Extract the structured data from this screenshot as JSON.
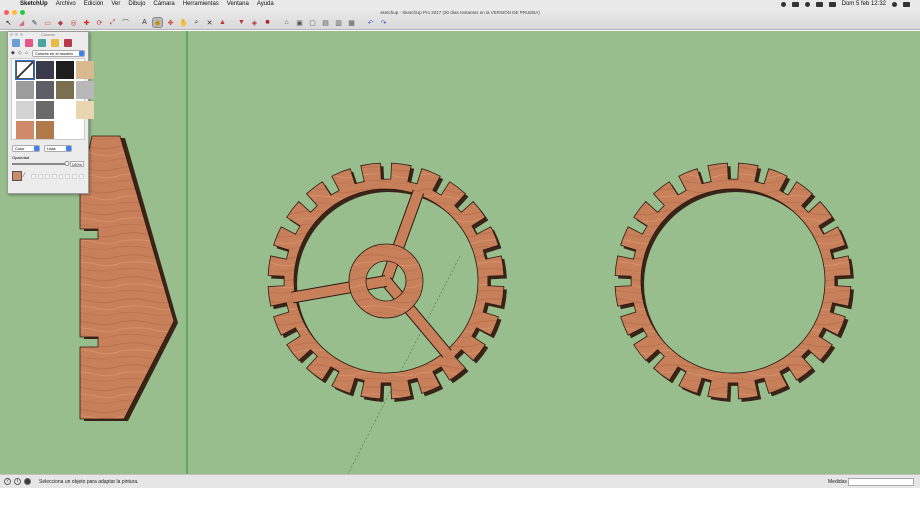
{
  "menubar": {
    "apple_symbol": "",
    "items": [
      "SketchUp",
      "Archivo",
      "Edición",
      "Ver",
      "Dibujo",
      "Cámara",
      "Herramientas",
      "Ventana",
      "Ayuda"
    ],
    "clock": "Dom 5 feb  12:32"
  },
  "window": {
    "title": "sketchup - SketchUp Pro 2017 (30 días restantes en la VERSIÓN DE PRUEBA)",
    "traffic_colors": [
      "#fe5f57",
      "#febc2e",
      "#28c840"
    ]
  },
  "toolbar": {
    "tools": [
      {
        "name": "select-tool",
        "glyph": "↖",
        "color": "#222",
        "active": false
      },
      {
        "name": "eraser-tool",
        "glyph": "◢",
        "color": "#d86a7c",
        "active": false
      },
      {
        "name": "line-tool",
        "glyph": "✎",
        "color": "#333",
        "active": false
      },
      {
        "name": "rectangle-tool",
        "glyph": "▭",
        "color": "#c54",
        "active": false
      },
      {
        "name": "push-pull-tool",
        "glyph": "◆",
        "color": "#a44",
        "active": false
      },
      {
        "name": "offset-tool",
        "glyph": "◎",
        "color": "#c33",
        "active": false
      },
      {
        "name": "move-tool",
        "glyph": "✚",
        "color": "#d22",
        "active": false
      },
      {
        "name": "rotate-tool",
        "glyph": "⟳",
        "color": "#c33",
        "active": false
      },
      {
        "name": "scale-tool",
        "glyph": "⤢",
        "color": "#c44",
        "active": false
      },
      {
        "name": "tape-measure-tool",
        "glyph": "⌒",
        "color": "#555",
        "active": false
      },
      {
        "name": "text-tool",
        "glyph": "A",
        "color": "#333",
        "active": false
      },
      {
        "name": "paint-bucket-tool",
        "glyph": "◉",
        "color": "#b80",
        "active": true
      },
      {
        "name": "orbit-tool",
        "glyph": "✥",
        "color": "#c33",
        "active": false
      },
      {
        "name": "pan-tool",
        "glyph": "✋",
        "color": "#b44",
        "active": false
      },
      {
        "name": "zoom-tool",
        "glyph": "⌕",
        "color": "#333",
        "active": false
      },
      {
        "name": "zoom-extents-tool",
        "glyph": "✕",
        "color": "#333",
        "active": false
      },
      {
        "name": "warehouse-tool",
        "glyph": "▲",
        "color": "#b33",
        "active": false
      },
      {
        "name": "share-model-tool",
        "glyph": "▼",
        "color": "#b33",
        "active": false
      },
      {
        "name": "components-tool",
        "glyph": "◈",
        "color": "#a33",
        "active": false
      },
      {
        "name": "extension-tool",
        "glyph": "■",
        "color": "#a22",
        "active": false
      },
      {
        "name": "iso-view-tool",
        "glyph": "⌂",
        "color": "#555",
        "active": false
      },
      {
        "name": "top-view-tool",
        "glyph": "▣",
        "color": "#555",
        "active": false
      },
      {
        "name": "front-view-tool",
        "glyph": "▢",
        "color": "#555",
        "active": false
      },
      {
        "name": "right-view-tool",
        "glyph": "▤",
        "color": "#555",
        "active": false
      },
      {
        "name": "back-view-tool",
        "glyph": "▥",
        "color": "#555",
        "active": false
      },
      {
        "name": "left-view-tool",
        "glyph": "▦",
        "color": "#555",
        "active": false
      },
      {
        "name": "undo-tool",
        "glyph": "↶",
        "color": "#36c",
        "active": false
      },
      {
        "name": "redo-tool",
        "glyph": "↷",
        "color": "#36c",
        "active": false
      }
    ]
  },
  "materials_panel": {
    "title": "Colores",
    "tab_colors": [
      "#6c9fd9",
      "#e3568a",
      "#4aa3a0",
      "#e9b949",
      "#b83a4a"
    ],
    "nav_icons": [
      "◆",
      "◇",
      "⌂"
    ],
    "model_select": "Colores en el modelo",
    "swatches": [
      {
        "color": "none",
        "selected": true
      },
      {
        "color": "#3a3a4a",
        "selected": false
      },
      {
        "color": "#1e1e1e",
        "selected": false
      },
      {
        "color": "#d9b98e",
        "selected": false
      },
      {
        "color": "#9c9c9c",
        "selected": false
      },
      {
        "color": "#5e5e66",
        "selected": false
      },
      {
        "color": "#7a7050",
        "selected": false
      },
      {
        "color": "#b8b8b8",
        "selected": false
      },
      {
        "color": "#d2d2d2",
        "selected": false
      },
      {
        "color": "#6a6a6a",
        "selected": false
      },
      {
        "color": "#ffffff",
        "selected": false
      },
      {
        "color": "#e8d6b0",
        "selected": false
      },
      {
        "color": "#d08a6a",
        "selected": false
      },
      {
        "color": "#b07a4a",
        "selected": false
      }
    ],
    "type_select": "Color",
    "list_select": "Lista",
    "opacity_label": "Opacidad",
    "opacity_value": "100%",
    "opacity_fraction": 1.0
  },
  "viewport": {
    "background": "#98be8e",
    "wood_color": "#c8805a",
    "edge_color": "#2a1a12"
  },
  "status": {
    "message": "Selecciona un objeto para adaptar la pintura.",
    "measure_label": "Medidas",
    "measure_value": ""
  }
}
